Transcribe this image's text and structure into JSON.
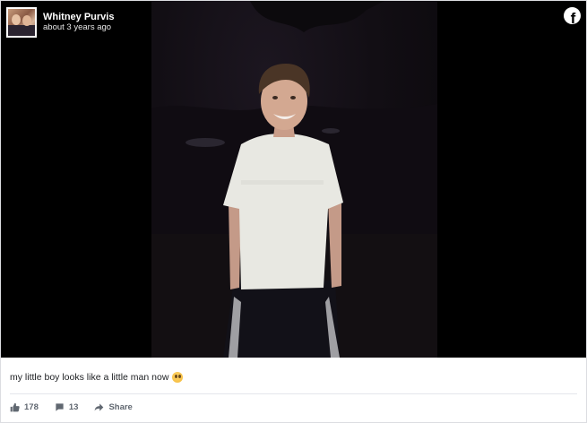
{
  "post": {
    "author_name": "Whitney Purvis",
    "timestamp": "about 3 years ago",
    "caption": "my little boy looks like a little man now",
    "caption_emoji": "teary-face-emoji",
    "brand_icon": "facebook-icon",
    "likes_count": "178",
    "comments_count": "13",
    "share_label": "Share"
  }
}
